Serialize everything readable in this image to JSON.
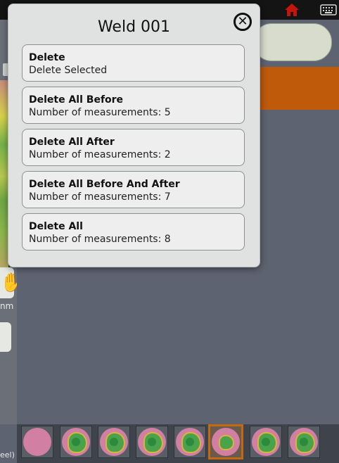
{
  "dialog": {
    "title": "Weld 001",
    "options": [
      {
        "title": "Delete",
        "subtitle": "Delete Selected"
      },
      {
        "title": "Delete All Before",
        "subtitle": "Number of measurements: 5"
      },
      {
        "title": "Delete All After",
        "subtitle": "Number of measurements: 2"
      },
      {
        "title": "Delete All Before And After",
        "subtitle": "Number of measurements: 7"
      },
      {
        "title": "Delete All",
        "subtitle": "Number of measurements: 8"
      }
    ]
  },
  "background": {
    "unit_label": "nm",
    "bottom_caption": "eel)"
  },
  "icons": {
    "home": "home-icon",
    "keyboard": "keyboard-icon",
    "close": "close-icon",
    "hand": "hand-icon"
  },
  "colors": {
    "accent": "#bf5a0a",
    "topbar": "#141414",
    "home_icon": "#c4150c"
  },
  "thumbnails": {
    "count": 8,
    "selected_index": 5
  }
}
